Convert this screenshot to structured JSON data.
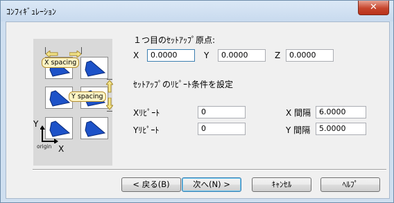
{
  "window": {
    "title": "ｺﾝﾌｨｷﾞｭﾚｰｼｮﾝ",
    "close_glyph": "✕"
  },
  "diagram": {
    "x_spacing_label": "X spacing",
    "y_spacing_label": "Y spacing",
    "axis_y": "Y",
    "axis_x": "X",
    "origin": "origin"
  },
  "origin_section": {
    "heading": "１つ目のｾｯﾄｱｯﾌﾟ原点:",
    "x_label": "X",
    "x_value": "0.0000",
    "y_label": "Y",
    "y_value": "0.0000",
    "z_label": "Z",
    "z_value": "0.0000"
  },
  "repeat_section": {
    "heading": "ｾｯﾄｱｯﾌﾟのﾘﾋﾟｰﾄ条件を設定",
    "x_repeat_label": "Xﾘﾋﾟｰﾄ",
    "x_repeat_value": "0",
    "y_repeat_label": "Yﾘﾋﾟｰﾄ",
    "y_repeat_value": "0",
    "x_interval_label": "X 間隔",
    "x_interval_value": "6.0000",
    "y_interval_label": "Y 間隔",
    "y_interval_value": "5.0000"
  },
  "buttons": {
    "back": "< 戻る(B)",
    "next": "次へ(N) >",
    "cancel": "ｷｬﾝｾﾙ",
    "help": "ﾍﾙﾌﾟ"
  }
}
